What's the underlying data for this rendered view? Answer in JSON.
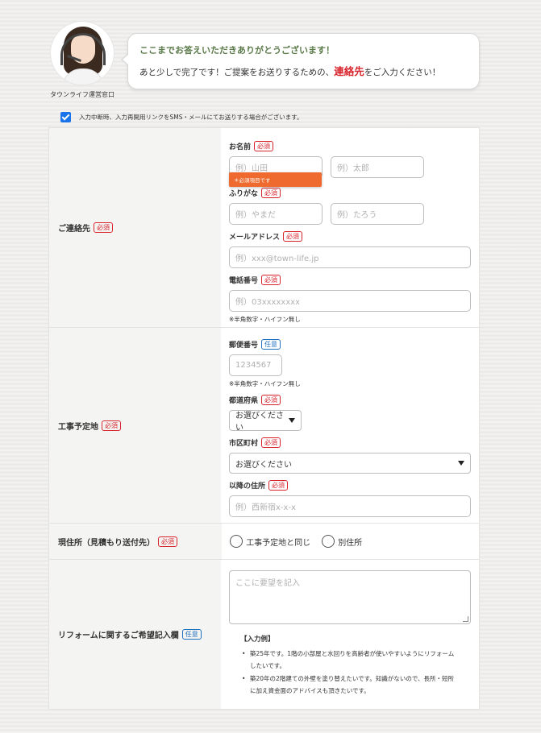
{
  "operator": {
    "label": "タウンライフ運営窓口",
    "avatar_icon": "operator-avatar"
  },
  "bubble": {
    "title": "ここまでお答えいただきありがとうございます！",
    "text_before": "あと少しで完了です！ご提案をお送りするための、",
    "highlight": "連絡先",
    "text_after": "をご入力ください！"
  },
  "consent": {
    "checked": true,
    "text": "入力中断時、入力再開用リンクをSMS・メールにてお送りする場合がございます。"
  },
  "badges": {
    "required": "必須",
    "optional": "任意"
  },
  "contact": {
    "section_label": "ご連絡先",
    "name": {
      "label": "お名前",
      "last_placeholder": "例）山田",
      "first_placeholder": "例）太郎"
    },
    "error_tip": "＊必須項目です",
    "furigana": {
      "label": "ふりがな",
      "last_placeholder": "例）やまだ",
      "first_placeholder": "例）たろう"
    },
    "email": {
      "label": "メールアドレス",
      "placeholder": "例）xxx@town-life.jp"
    },
    "phone": {
      "label": "電話番号",
      "placeholder": "例）03xxxxxxxx",
      "note": "※半角数字・ハイフン無し"
    }
  },
  "site": {
    "section_label": "工事予定地",
    "postal": {
      "label": "郵便番号",
      "placeholder": "1234567",
      "note": "※半角数字・ハイフン無し"
    },
    "prefecture": {
      "label": "都道府県",
      "value": "お選びください"
    },
    "city": {
      "label": "市区町村",
      "value": "お選びください"
    },
    "address": {
      "label": "以降の住所",
      "placeholder": "例）西新宿x-x-x"
    }
  },
  "current_address": {
    "section_label": "現住所（見積もり送付先）",
    "options": [
      "工事予定地と同じ",
      "別住所"
    ]
  },
  "request": {
    "section_label": "リフォームに関するご希望記入欄",
    "placeholder": "ここに要望を記入",
    "example_title": "【入力例】",
    "examples": [
      "築25年です。1階の小部屋と水回りを高齢者が使いやすいようにリフォームしたいです。",
      "築20年の2階建ての外壁を塗り替えたいです。知識がないので、長所・短所に加え資金面のアドバイスも頂きたいです。"
    ]
  }
}
